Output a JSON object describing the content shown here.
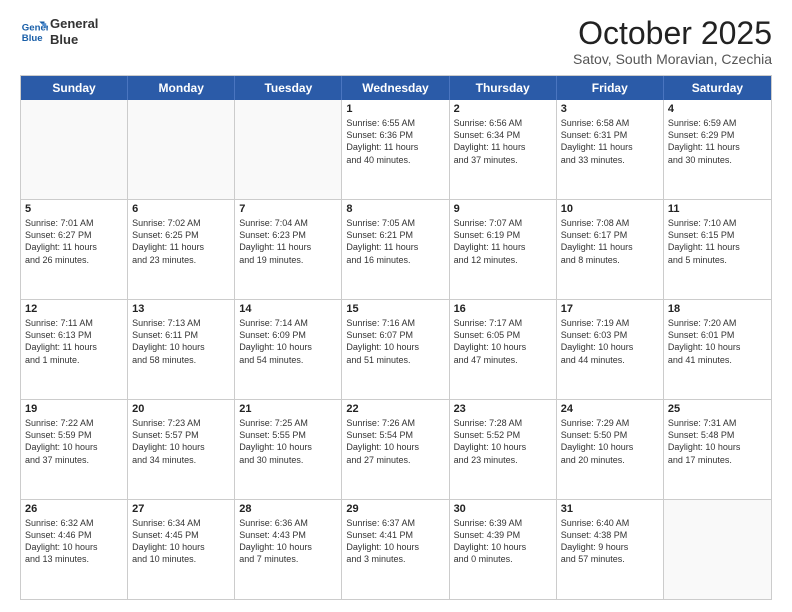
{
  "logo": {
    "line1": "General",
    "line2": "Blue"
  },
  "title": "October 2025",
  "subtitle": "Satov, South Moravian, Czechia",
  "days": [
    "Sunday",
    "Monday",
    "Tuesday",
    "Wednesday",
    "Thursday",
    "Friday",
    "Saturday"
  ],
  "weeks": [
    [
      {
        "day": "",
        "text": ""
      },
      {
        "day": "",
        "text": ""
      },
      {
        "day": "",
        "text": ""
      },
      {
        "day": "1",
        "text": "Sunrise: 6:55 AM\nSunset: 6:36 PM\nDaylight: 11 hours\nand 40 minutes."
      },
      {
        "day": "2",
        "text": "Sunrise: 6:56 AM\nSunset: 6:34 PM\nDaylight: 11 hours\nand 37 minutes."
      },
      {
        "day": "3",
        "text": "Sunrise: 6:58 AM\nSunset: 6:31 PM\nDaylight: 11 hours\nand 33 minutes."
      },
      {
        "day": "4",
        "text": "Sunrise: 6:59 AM\nSunset: 6:29 PM\nDaylight: 11 hours\nand 30 minutes."
      }
    ],
    [
      {
        "day": "5",
        "text": "Sunrise: 7:01 AM\nSunset: 6:27 PM\nDaylight: 11 hours\nand 26 minutes."
      },
      {
        "day": "6",
        "text": "Sunrise: 7:02 AM\nSunset: 6:25 PM\nDaylight: 11 hours\nand 23 minutes."
      },
      {
        "day": "7",
        "text": "Sunrise: 7:04 AM\nSunset: 6:23 PM\nDaylight: 11 hours\nand 19 minutes."
      },
      {
        "day": "8",
        "text": "Sunrise: 7:05 AM\nSunset: 6:21 PM\nDaylight: 11 hours\nand 16 minutes."
      },
      {
        "day": "9",
        "text": "Sunrise: 7:07 AM\nSunset: 6:19 PM\nDaylight: 11 hours\nand 12 minutes."
      },
      {
        "day": "10",
        "text": "Sunrise: 7:08 AM\nSunset: 6:17 PM\nDaylight: 11 hours\nand 8 minutes."
      },
      {
        "day": "11",
        "text": "Sunrise: 7:10 AM\nSunset: 6:15 PM\nDaylight: 11 hours\nand 5 minutes."
      }
    ],
    [
      {
        "day": "12",
        "text": "Sunrise: 7:11 AM\nSunset: 6:13 PM\nDaylight: 11 hours\nand 1 minute."
      },
      {
        "day": "13",
        "text": "Sunrise: 7:13 AM\nSunset: 6:11 PM\nDaylight: 10 hours\nand 58 minutes."
      },
      {
        "day": "14",
        "text": "Sunrise: 7:14 AM\nSunset: 6:09 PM\nDaylight: 10 hours\nand 54 minutes."
      },
      {
        "day": "15",
        "text": "Sunrise: 7:16 AM\nSunset: 6:07 PM\nDaylight: 10 hours\nand 51 minutes."
      },
      {
        "day": "16",
        "text": "Sunrise: 7:17 AM\nSunset: 6:05 PM\nDaylight: 10 hours\nand 47 minutes."
      },
      {
        "day": "17",
        "text": "Sunrise: 7:19 AM\nSunset: 6:03 PM\nDaylight: 10 hours\nand 44 minutes."
      },
      {
        "day": "18",
        "text": "Sunrise: 7:20 AM\nSunset: 6:01 PM\nDaylight: 10 hours\nand 41 minutes."
      }
    ],
    [
      {
        "day": "19",
        "text": "Sunrise: 7:22 AM\nSunset: 5:59 PM\nDaylight: 10 hours\nand 37 minutes."
      },
      {
        "day": "20",
        "text": "Sunrise: 7:23 AM\nSunset: 5:57 PM\nDaylight: 10 hours\nand 34 minutes."
      },
      {
        "day": "21",
        "text": "Sunrise: 7:25 AM\nSunset: 5:55 PM\nDaylight: 10 hours\nand 30 minutes."
      },
      {
        "day": "22",
        "text": "Sunrise: 7:26 AM\nSunset: 5:54 PM\nDaylight: 10 hours\nand 27 minutes."
      },
      {
        "day": "23",
        "text": "Sunrise: 7:28 AM\nSunset: 5:52 PM\nDaylight: 10 hours\nand 23 minutes."
      },
      {
        "day": "24",
        "text": "Sunrise: 7:29 AM\nSunset: 5:50 PM\nDaylight: 10 hours\nand 20 minutes."
      },
      {
        "day": "25",
        "text": "Sunrise: 7:31 AM\nSunset: 5:48 PM\nDaylight: 10 hours\nand 17 minutes."
      }
    ],
    [
      {
        "day": "26",
        "text": "Sunrise: 6:32 AM\nSunset: 4:46 PM\nDaylight: 10 hours\nand 13 minutes."
      },
      {
        "day": "27",
        "text": "Sunrise: 6:34 AM\nSunset: 4:45 PM\nDaylight: 10 hours\nand 10 minutes."
      },
      {
        "day": "28",
        "text": "Sunrise: 6:36 AM\nSunset: 4:43 PM\nDaylight: 10 hours\nand 7 minutes."
      },
      {
        "day": "29",
        "text": "Sunrise: 6:37 AM\nSunset: 4:41 PM\nDaylight: 10 hours\nand 3 minutes."
      },
      {
        "day": "30",
        "text": "Sunrise: 6:39 AM\nSunset: 4:39 PM\nDaylight: 10 hours\nand 0 minutes."
      },
      {
        "day": "31",
        "text": "Sunrise: 6:40 AM\nSunset: 4:38 PM\nDaylight: 9 hours\nand 57 minutes."
      },
      {
        "day": "",
        "text": ""
      }
    ]
  ]
}
